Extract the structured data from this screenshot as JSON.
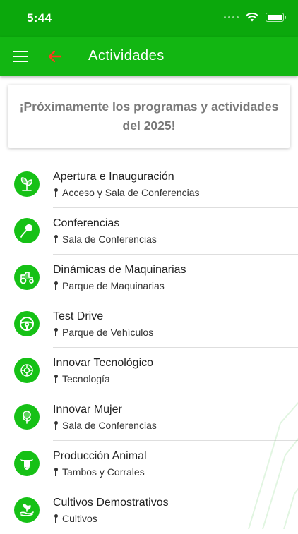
{
  "status_bar": {
    "time": "5:44"
  },
  "app_bar": {
    "title": "Actividades"
  },
  "notice": {
    "text": "¡Próximamente los programas y actividades del 2025!"
  },
  "activities": [
    {
      "title": "Apertura e Inauguración",
      "place": "Acceso y Sala de Conferencias",
      "icon": "leaf-icon"
    },
    {
      "title": "Conferencias",
      "place": "Sala de Conferencias",
      "icon": "microphone-icon"
    },
    {
      "title": "Dinámicas de Maquinarias",
      "place": "Parque de Maquinarias",
      "icon": "tractor-icon"
    },
    {
      "title": "Test Drive",
      "place": "Parque de Vehículos",
      "icon": "steering-wheel-icon"
    },
    {
      "title": "Innovar Tecnológico",
      "place": "Tecnología",
      "icon": "technology-icon"
    },
    {
      "title": "Innovar Mujer",
      "place": "Sala de Conferencias",
      "icon": "woman-plant-icon"
    },
    {
      "title": "Producción Animal",
      "place": "Tambos y Corrales",
      "icon": "cow-icon"
    },
    {
      "title": "Cultivos Demostrativos",
      "place": "Cultivos",
      "icon": "plant-hand-icon"
    }
  ],
  "colors": {
    "status_bar": "#0ba80c",
    "app_bar": "#12b612",
    "icon_bg": "#16c116",
    "back_arrow": "#ff3b1f"
  }
}
